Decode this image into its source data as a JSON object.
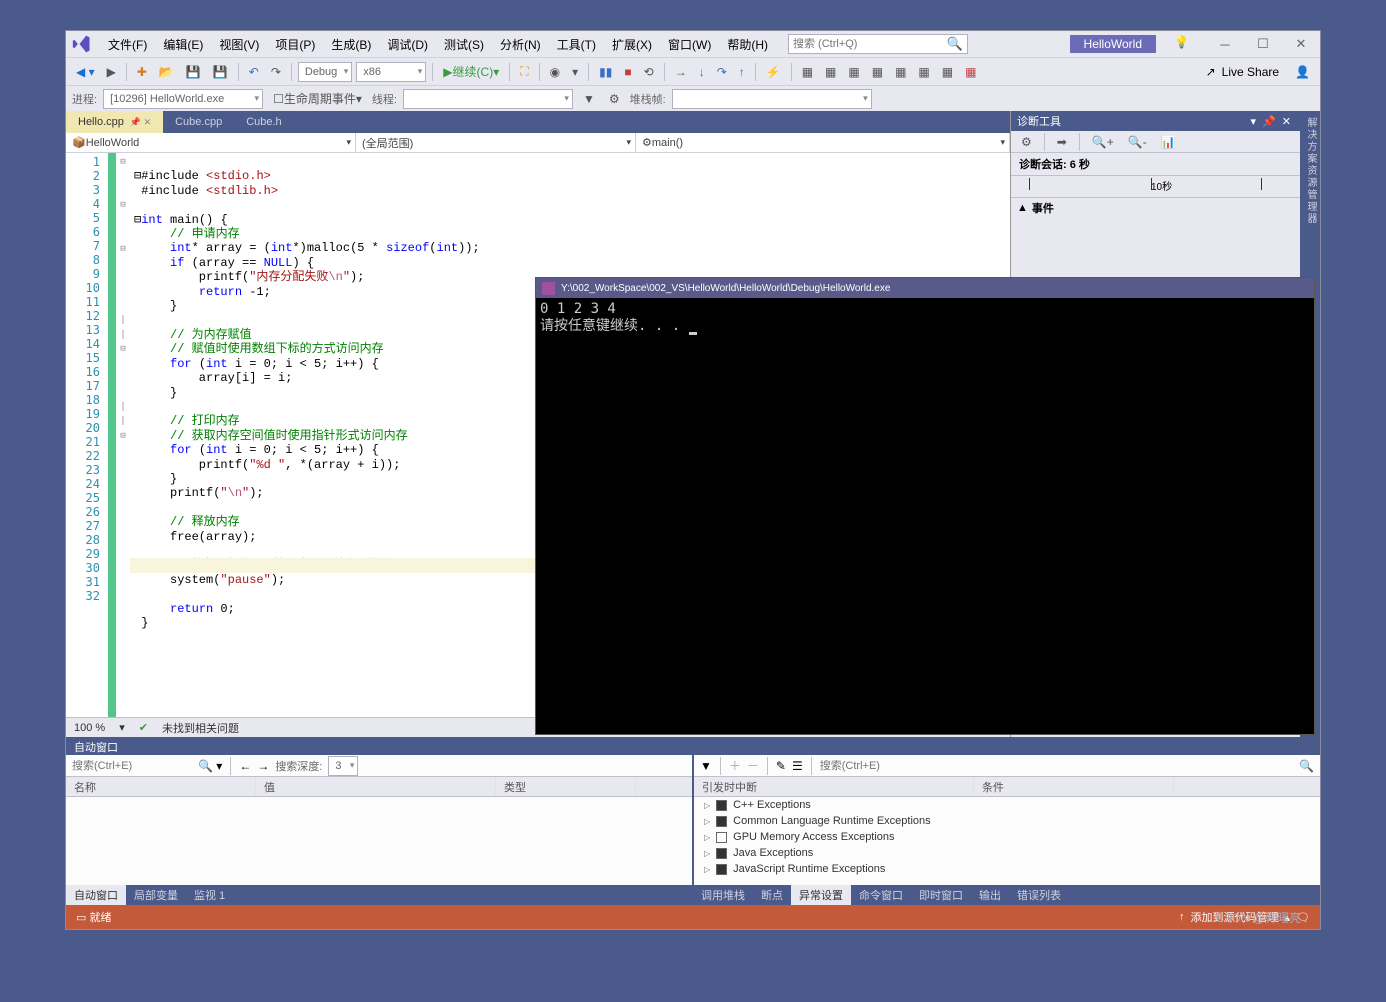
{
  "menu": [
    "文件(F)",
    "编辑(E)",
    "视图(V)",
    "项目(P)",
    "生成(B)",
    "调试(D)",
    "测试(S)",
    "分析(N)",
    "工具(T)",
    "扩展(X)",
    "窗口(W)",
    "帮助(H)"
  ],
  "search_placeholder": "搜索 (Ctrl+Q)",
  "title_project": "HelloWorld",
  "toolbar": {
    "config": "Debug",
    "platform": "x86",
    "continue": "继续(C)",
    "live_share": "Live Share"
  },
  "toolbar2": {
    "process_label": "进程:",
    "process_value": "[10296] HelloWorld.exe",
    "lifecycle": "生命周期事件",
    "thread": "线程:",
    "stackframe": "堆栈帧:"
  },
  "tabs": [
    {
      "label": "Hello.cpp",
      "active": true,
      "pinned": true
    },
    {
      "label": "Cube.cpp",
      "active": false
    },
    {
      "label": "Cube.h",
      "active": false
    }
  ],
  "nav": {
    "scope1": "HelloWorld",
    "scope2": "(全局范围)",
    "scope3": "main()"
  },
  "code_lines": 32,
  "editor_status": {
    "zoom": "100 %",
    "issues": "未找到相关问题"
  },
  "diag": {
    "title": "诊断工具",
    "session": "诊断会话: 6 秒",
    "ruler_label": "10秒",
    "events": "事件"
  },
  "vert_tab": "解决方案资源管理器",
  "auto_panel": "自动窗口",
  "btm_left": {
    "search_placeholder": "搜索(Ctrl+E)",
    "depth_label": "搜索深度:",
    "cols": [
      "名称",
      "值",
      "类型"
    ]
  },
  "btm_right": {
    "search_placeholder": "搜索(Ctrl+E)",
    "cols": [
      "引发时中断",
      "条件"
    ],
    "exceptions": [
      {
        "label": "C++ Exceptions",
        "checked": true
      },
      {
        "label": "Common Language Runtime Exceptions",
        "checked": true
      },
      {
        "label": "GPU Memory Access Exceptions",
        "checked": false
      },
      {
        "label": "Java Exceptions",
        "checked": true
      },
      {
        "label": "JavaScript Runtime Exceptions",
        "checked": true
      }
    ]
  },
  "btm_tabs_left": [
    "自动窗口",
    "局部变量",
    "监视 1"
  ],
  "btm_tabs_right": [
    "调用堆栈",
    "断点",
    "异常设置",
    "命令窗口",
    "即时窗口",
    "输出",
    "错误列表"
  ],
  "btm_tabs_left_active": 0,
  "btm_tabs_right_active": 2,
  "status": {
    "ready": "就绪",
    "source_control": "添加到源代码管理"
  },
  "console": {
    "title": "Y:\\002_WorkSpace\\002_VS\\HelloWorld\\HelloWorld\\Debug\\HelloWorld.exe",
    "line1": "0 1 2 3 4 ",
    "line2": "请按任意键继续. . . "
  },
  "watermark": "CSDN @韩曙亮"
}
